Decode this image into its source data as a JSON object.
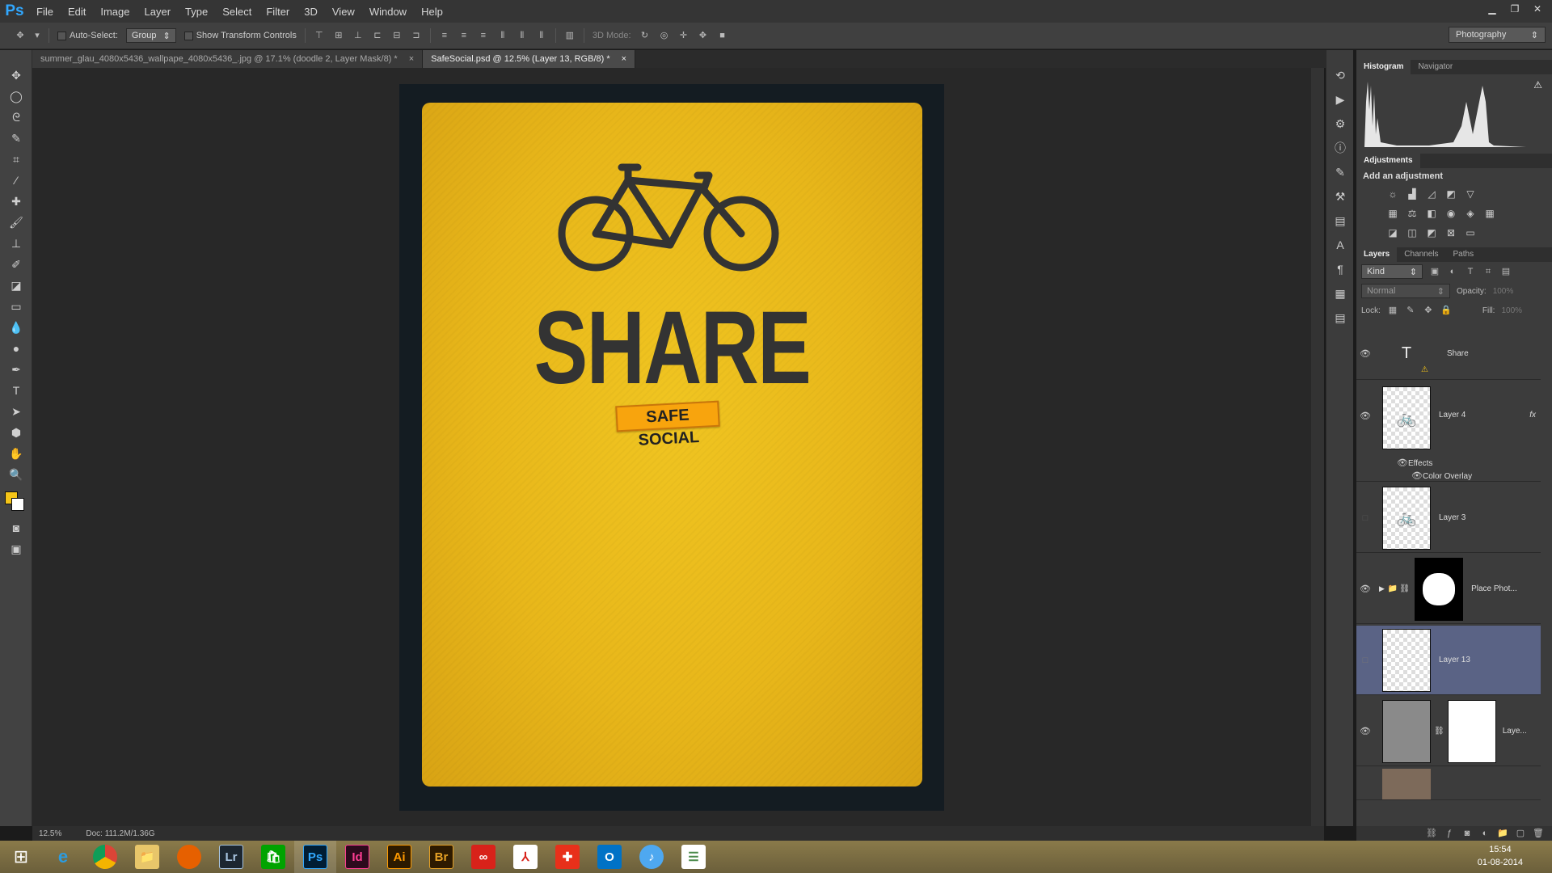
{
  "menubar": {
    "logo": "Ps",
    "items": [
      "File",
      "Edit",
      "Image",
      "Layer",
      "Type",
      "Select",
      "Filter",
      "3D",
      "View",
      "Window",
      "Help"
    ]
  },
  "options": {
    "auto_select_label": "Auto-Select:",
    "auto_select_value": "Group",
    "transform_label": "Show Transform Controls",
    "mode_3d_label": "3D Mode:",
    "workspace": "Photography"
  },
  "tabs": [
    {
      "label": "summer_glau_4080x5436_wallpape_4080x5436_.jpg @ 17.1% (doodle 2, Layer Mask/8) *",
      "close": "×"
    },
    {
      "label": "SafeSocial.psd @ 12.5% (Layer 13, RGB/8) *",
      "close": "×"
    }
  ],
  "poster": {
    "title": "SHARE",
    "badge": "SAFE SOCIAL",
    "bg_color": "#e8b71a"
  },
  "status": {
    "zoom": "12.5%",
    "doc_size": "Doc: 111.2M/1.36G"
  },
  "panels": {
    "histogram_tab": "Histogram",
    "navigator_tab": "Navigator",
    "adjustments_tab": "Adjustments",
    "adjustments_heading": "Add an adjustment",
    "layers_tab": "Layers",
    "channels_tab": "Channels",
    "paths_tab": "Paths",
    "kind_filter": "Kind",
    "blend_mode": "Normal",
    "opacity_label": "Opacity:",
    "opacity_value": "100%",
    "lock_label": "Lock:",
    "fill_label": "Fill:",
    "fill_value": "100%"
  },
  "layers": [
    {
      "name": "Share"
    },
    {
      "name": "Layer 4",
      "fx": "fx",
      "effects": "Effects",
      "effect_item": "Color Overlay"
    },
    {
      "name": "Layer 3"
    },
    {
      "name": "Place Phot..."
    },
    {
      "name": "Layer 13"
    },
    {
      "name": "Laye..."
    }
  ],
  "taskbar": {
    "apps": [
      "Lr",
      "Ps",
      "Id",
      "Ai",
      "Br"
    ],
    "time": "15:54",
    "date": "01-08-2014"
  }
}
